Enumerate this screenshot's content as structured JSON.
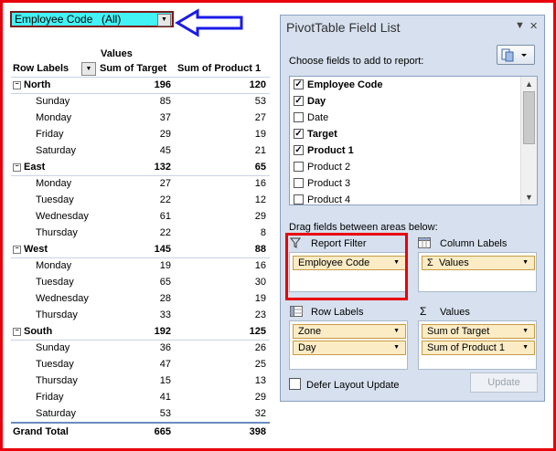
{
  "filter": {
    "field": "Employee Code",
    "value": "(All)"
  },
  "pivot": {
    "values_header": "Values",
    "row_labels": "Row Labels",
    "col1": "Sum of Target",
    "col2": "Sum of Product 1",
    "rows": [
      {
        "label": "North",
        "v1": "196",
        "v2": "120",
        "bold": true
      },
      {
        "label": "Sunday",
        "v1": "85",
        "v2": "53"
      },
      {
        "label": "Monday",
        "v1": "37",
        "v2": "27"
      },
      {
        "label": "Friday",
        "v1": "29",
        "v2": "19"
      },
      {
        "label": "Saturday",
        "v1": "45",
        "v2": "21"
      },
      {
        "label": "East",
        "v1": "132",
        "v2": "65",
        "bold": true
      },
      {
        "label": "Monday",
        "v1": "27",
        "v2": "16"
      },
      {
        "label": "Tuesday",
        "v1": "22",
        "v2": "12"
      },
      {
        "label": "Wednesday",
        "v1": "61",
        "v2": "29"
      },
      {
        "label": "Thursday",
        "v1": "22",
        "v2": "8"
      },
      {
        "label": "West",
        "v1": "145",
        "v2": "88",
        "bold": true
      },
      {
        "label": "Monday",
        "v1": "19",
        "v2": "16"
      },
      {
        "label": "Tuesday",
        "v1": "65",
        "v2": "30"
      },
      {
        "label": "Wednesday",
        "v1": "28",
        "v2": "19"
      },
      {
        "label": "Thursday",
        "v1": "33",
        "v2": "23"
      },
      {
        "label": "South",
        "v1": "192",
        "v2": "125",
        "bold": true
      },
      {
        "label": "Sunday",
        "v1": "36",
        "v2": "26"
      },
      {
        "label": "Tuesday",
        "v1": "47",
        "v2": "25"
      },
      {
        "label": "Thursday",
        "v1": "15",
        "v2": "13"
      },
      {
        "label": "Friday",
        "v1": "41",
        "v2": "29"
      },
      {
        "label": "Saturday",
        "v1": "53",
        "v2": "32"
      }
    ],
    "grand_total": {
      "label": "Grand Total",
      "v1": "665",
      "v2": "398"
    }
  },
  "panel": {
    "title": "PivotTable Field List",
    "choose_label": "Choose fields to add to report:",
    "fields": [
      {
        "label": "Employee Code",
        "checked": true
      },
      {
        "label": "Day",
        "checked": true
      },
      {
        "label": "Date",
        "checked": false
      },
      {
        "label": "Target",
        "checked": true
      },
      {
        "label": "Product 1",
        "checked": true
      },
      {
        "label": "Product 2",
        "checked": false
      },
      {
        "label": "Product 3",
        "checked": false
      },
      {
        "label": "Product 4",
        "checked": false
      }
    ],
    "drag_label": "Drag fields between areas below:",
    "report_filter_label": "Report Filter",
    "column_labels_label": "Column Labels",
    "row_labels_label": "Row Labels",
    "values_label": "Values",
    "filter_chip": "Employee Code",
    "column_chip": "Values",
    "row_chips": [
      "Zone",
      "Day"
    ],
    "value_chips": [
      "Sum of Target",
      "Sum of Product 1"
    ],
    "defer_label": "Defer Layout Update",
    "update_label": "Update",
    "sigma": "Σ"
  },
  "colors": {
    "frame_red": "#e8000b",
    "filter_cyan": "#42f2f5",
    "arrow_blue": "#1a1ae8",
    "panel_bg": "#d6e0ee",
    "chip_bg": "#fbecc6"
  }
}
